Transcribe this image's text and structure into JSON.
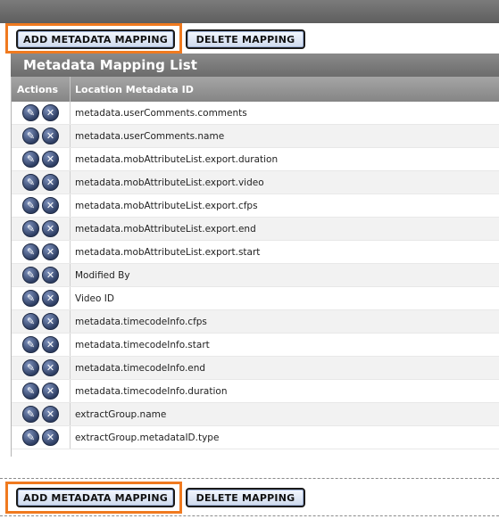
{
  "buttons": {
    "add_label": "ADD METADATA MAPPING",
    "delete_label": "DELETE MAPPING"
  },
  "list": {
    "title": "Metadata Mapping List",
    "headers": {
      "actions": "Actions",
      "location_id": "Location Metadata ID"
    },
    "rows": [
      "metadata.userComments.comments",
      "metadata.userComments.name",
      "metadata.mobAttributeList.export.duration",
      "metadata.mobAttributeList.export.video",
      "metadata.mobAttributeList.export.cfps",
      "metadata.mobAttributeList.export.end",
      "metadata.mobAttributeList.export.start",
      "Modified By",
      "Video ID",
      "metadata.timecodeInfo.cfps",
      "metadata.timecodeInfo.start",
      "metadata.timecodeInfo.end",
      "metadata.timecodeInfo.duration",
      "extractGroup.name",
      "extractGroup.metadataID.type"
    ]
  },
  "icons": {
    "edit": "pencil-icon",
    "delete": "close-icon"
  },
  "colors": {
    "highlight": "#f07a1f",
    "header": "#8a8a8a"
  }
}
